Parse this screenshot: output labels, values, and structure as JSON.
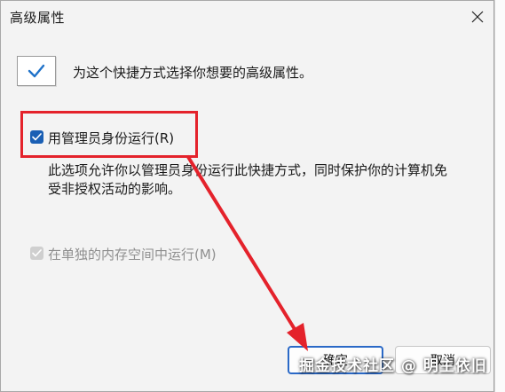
{
  "window": {
    "title": "高级属性",
    "close_icon": "close-icon"
  },
  "intro": {
    "icon": "checkmark-icon",
    "text": "为这个快捷方式选择你想要的高级属性。"
  },
  "options": {
    "run_as_admin": {
      "label": "用管理员身份运行(R)",
      "checked": true,
      "enabled": true
    },
    "description": "此选项允许你以管理员身份运行此快捷方式，同时保护你的计算机免受非授权活动的影响。",
    "separate_memory": {
      "label": "在单独的内存空间中运行(M)",
      "checked": true,
      "enabled": false
    }
  },
  "buttons": {
    "ok_label": "确定",
    "cancel_label": "取消"
  },
  "annotation": {
    "color": "#e4222b"
  },
  "watermark": {
    "text": "掘金技术社区 @ 明主依旧"
  },
  "colors": {
    "accent": "#1a5fb4",
    "highlight": "#e4222b"
  }
}
